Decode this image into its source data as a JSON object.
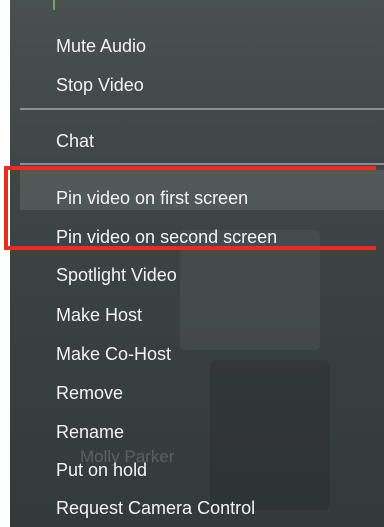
{
  "menu": {
    "items": [
      {
        "label": "Mute Audio"
      },
      {
        "label": "Stop Video"
      },
      {
        "label": "Chat"
      },
      {
        "label": "Pin video on first screen"
      },
      {
        "label": "Pin video on second screen"
      },
      {
        "label": "Spotlight Video"
      },
      {
        "label": "Make Host"
      },
      {
        "label": "Make Co-Host"
      },
      {
        "label": "Remove"
      },
      {
        "label": "Rename"
      },
      {
        "label": "Put on hold"
      },
      {
        "label": "Request Camera Control"
      }
    ]
  },
  "background": {
    "participant_name": "Molly Parker"
  },
  "colors": {
    "menu_bg": "#3f4546",
    "text": "#f2f4f4",
    "separator": "#8a8f90",
    "highlight_border": "#ee2a1f"
  }
}
